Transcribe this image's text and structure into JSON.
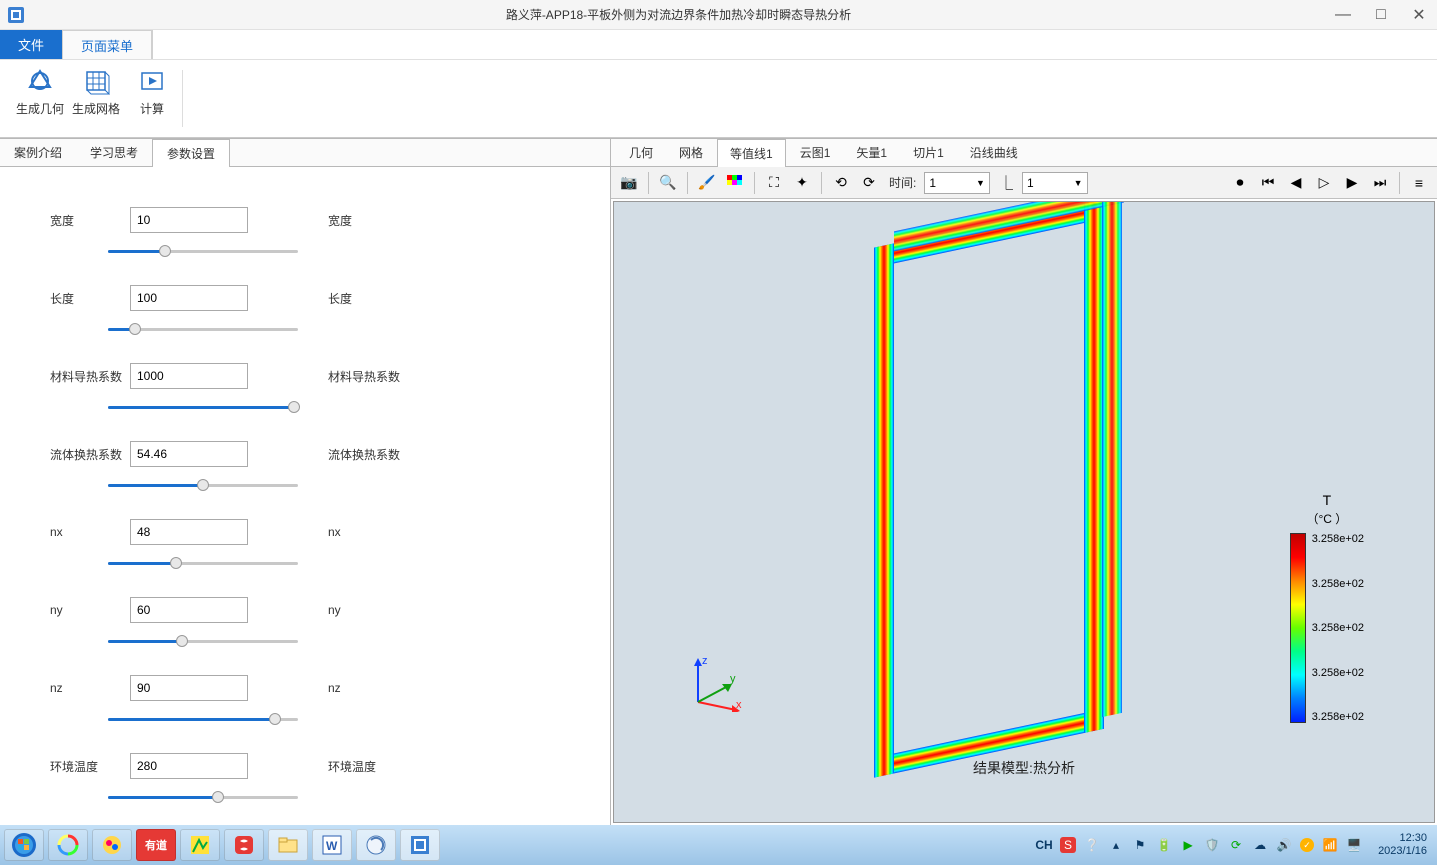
{
  "window": {
    "title": "路义萍-APP18-平板外侧为对流边界条件加热冷却时瞬态导热分析"
  },
  "window_controls": {
    "minimize": "—",
    "maximize": "□",
    "close": "✕"
  },
  "menubar": {
    "file": "文件",
    "pagemenu": "页面菜单"
  },
  "ribbon": {
    "gen_geom": "生成几何",
    "gen_mesh": "生成网格",
    "compute": "计算"
  },
  "left_tabs": {
    "intro": "案例介绍",
    "study": "学习思考",
    "params": "参数设置"
  },
  "params": [
    {
      "label": "宽度",
      "value": "10",
      "extra": "宽度",
      "pct": 30
    },
    {
      "label": "长度",
      "value": "100",
      "extra": "长度",
      "pct": 14
    },
    {
      "label": "材料导热系数",
      "value": "1000",
      "extra": "材料导热系数",
      "pct": 98
    },
    {
      "label": "流体换热系数",
      "value": "54.46",
      "extra": "流体换热系数",
      "pct": 50
    },
    {
      "label": "nx",
      "value": "48",
      "extra": "nx",
      "pct": 36
    },
    {
      "label": "ny",
      "value": "60",
      "extra": "ny",
      "pct": 39
    },
    {
      "label": "nz",
      "value": "90",
      "extra": "nz",
      "pct": 88
    },
    {
      "label": "环境温度",
      "value": "280",
      "extra": "环境温度",
      "pct": 58
    }
  ],
  "right_tabs": [
    {
      "label": "几何",
      "active": false
    },
    {
      "label": "网格",
      "active": false
    },
    {
      "label": "等值线1",
      "active": true
    },
    {
      "label": "云图1",
      "active": false
    },
    {
      "label": "矢量1",
      "active": false
    },
    {
      "label": "切片1",
      "active": false
    },
    {
      "label": "沿线曲线",
      "active": false
    }
  ],
  "right_toolbar": {
    "time_label": "时间:",
    "combo1": "1",
    "combo2": "1"
  },
  "viewport": {
    "caption": "结果模型:热分析",
    "axes": {
      "x": "x",
      "y": "y",
      "z": "z"
    },
    "colorbar": {
      "title": "T",
      "subtitle": "（°C ）",
      "labels": [
        "3.258e+02",
        "3.258e+02",
        "3.258e+02",
        "3.258e+02",
        "3.258e+02"
      ]
    }
  },
  "taskbar": {
    "lang": "CH",
    "time": "12:30",
    "date": "2023/1/16"
  }
}
